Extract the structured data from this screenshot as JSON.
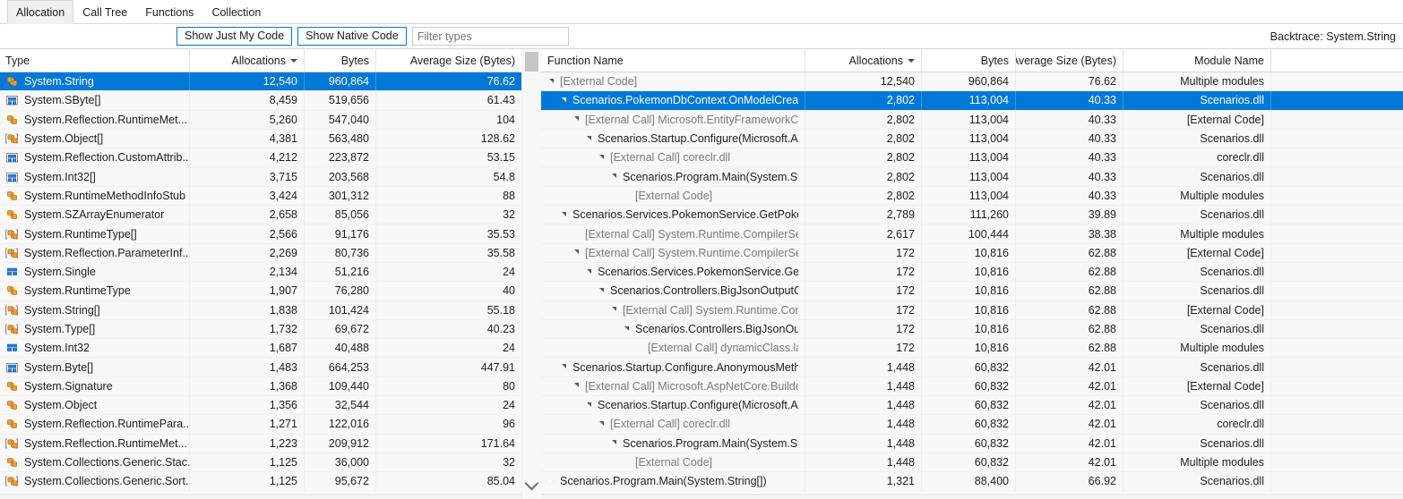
{
  "tabs": [
    {
      "label": "Allocation",
      "active": true
    },
    {
      "label": "Call Tree",
      "active": false
    },
    {
      "label": "Functions",
      "active": false
    },
    {
      "label": "Collection",
      "active": false
    }
  ],
  "toolbar": {
    "just_my_code_label": "Show Just My Code",
    "native_code_label": "Show Native Code",
    "filter_value": "",
    "filter_placeholder": "Filter types",
    "backtrace_label": "Backtrace: System.String"
  },
  "colors": {
    "selection": "#0078d7",
    "accent_border": "#0078d4",
    "row_bg": "#f8f8f8",
    "external_text": "#7a7a7a"
  },
  "types_grid": {
    "columns": [
      {
        "key": "type",
        "label": "Type",
        "align": "left",
        "sorted": false
      },
      {
        "key": "allocations",
        "label": "Allocations",
        "align": "right",
        "sorted": true
      },
      {
        "key": "bytes",
        "label": "Bytes",
        "align": "right",
        "sorted": false
      },
      {
        "key": "average",
        "label": "Average Size (Bytes)",
        "align": "right",
        "sorted": false
      }
    ],
    "rows": [
      {
        "icon": "class-icon",
        "type": "System.String",
        "allocations": "12,540",
        "bytes": "960,864",
        "average": "76.62",
        "selected": true
      },
      {
        "icon": "struct-array-icon",
        "type": "System.SByte[]",
        "allocations": "8,459",
        "bytes": "519,656",
        "average": "61.43",
        "selected": false
      },
      {
        "icon": "class-icon",
        "type": "System.Reflection.RuntimeMet...",
        "allocations": "5,260",
        "bytes": "547,040",
        "average": "104",
        "selected": false
      },
      {
        "icon": "class-array-icon",
        "type": "System.Object[]",
        "allocations": "4,381",
        "bytes": "563,480",
        "average": "128.62",
        "selected": false
      },
      {
        "icon": "struct-array-icon",
        "type": "System.Reflection.CustomAttrib...",
        "allocations": "4,212",
        "bytes": "223,872",
        "average": "53.15",
        "selected": false
      },
      {
        "icon": "struct-array-icon",
        "type": "System.Int32[]",
        "allocations": "3,715",
        "bytes": "203,568",
        "average": "54.8",
        "selected": false
      },
      {
        "icon": "class-icon",
        "type": "System.RuntimeMethodInfoStub",
        "allocations": "3,424",
        "bytes": "301,312",
        "average": "88",
        "selected": false
      },
      {
        "icon": "class-icon",
        "type": "System.SZArrayEnumerator",
        "allocations": "2,658",
        "bytes": "85,056",
        "average": "32",
        "selected": false
      },
      {
        "icon": "class-array-icon",
        "type": "System.RuntimeType[]",
        "allocations": "2,566",
        "bytes": "91,176",
        "average": "35.53",
        "selected": false
      },
      {
        "icon": "class-array-icon",
        "type": "System.Reflection.ParameterInf...",
        "allocations": "2,269",
        "bytes": "80,736",
        "average": "35.58",
        "selected": false
      },
      {
        "icon": "struct-icon",
        "type": "System.Single",
        "allocations": "2,134",
        "bytes": "51,216",
        "average": "24",
        "selected": false
      },
      {
        "icon": "class-icon",
        "type": "System.RuntimeType",
        "allocations": "1,907",
        "bytes": "76,280",
        "average": "40",
        "selected": false
      },
      {
        "icon": "class-array-icon",
        "type": "System.String[]",
        "allocations": "1,838",
        "bytes": "101,424",
        "average": "55.18",
        "selected": false
      },
      {
        "icon": "class-array-icon",
        "type": "System.Type[]",
        "allocations": "1,732",
        "bytes": "69,672",
        "average": "40.23",
        "selected": false
      },
      {
        "icon": "struct-icon",
        "type": "System.Int32",
        "allocations": "1,687",
        "bytes": "40,488",
        "average": "24",
        "selected": false
      },
      {
        "icon": "struct-array-icon",
        "type": "System.Byte[]",
        "allocations": "1,483",
        "bytes": "664,253",
        "average": "447.91",
        "selected": false
      },
      {
        "icon": "class-icon",
        "type": "System.Signature",
        "allocations": "1,368",
        "bytes": "109,440",
        "average": "80",
        "selected": false
      },
      {
        "icon": "class-icon",
        "type": "System.Object",
        "allocations": "1,356",
        "bytes": "32,544",
        "average": "24",
        "selected": false
      },
      {
        "icon": "class-icon",
        "type": "System.Reflection.RuntimePara...",
        "allocations": "1,271",
        "bytes": "122,016",
        "average": "96",
        "selected": false
      },
      {
        "icon": "class-array-icon",
        "type": "System.Reflection.RuntimeMet...",
        "allocations": "1,223",
        "bytes": "209,912",
        "average": "171.64",
        "selected": false
      },
      {
        "icon": "class-icon",
        "type": "System.Collections.Generic.Stac...",
        "allocations": "1,125",
        "bytes": "36,000",
        "average": "32",
        "selected": false
      },
      {
        "icon": "class-array-icon",
        "type": "System.Collections.Generic.Sort...",
        "allocations": "1,125",
        "bytes": "95,672",
        "average": "85.04",
        "selected": false
      }
    ]
  },
  "backtrace_grid": {
    "columns": [
      {
        "key": "function",
        "label": "Function Name",
        "align": "left",
        "sorted": false
      },
      {
        "key": "allocations",
        "label": "Allocations",
        "align": "right",
        "sorted": true
      },
      {
        "key": "bytes",
        "label": "Bytes",
        "align": "right",
        "sorted": false
      },
      {
        "key": "average",
        "label": "Average Size (Bytes)",
        "align": "right",
        "sorted": false
      },
      {
        "key": "module",
        "label": "Module Name",
        "align": "right",
        "sorted": false
      }
    ],
    "rows": [
      {
        "depth": 0,
        "twisty": "expanded",
        "function": "[External Code]",
        "external": true,
        "allocations": "12,540",
        "bytes": "960,864",
        "average": "76.62",
        "module": "Multiple modules",
        "selected": false
      },
      {
        "depth": 1,
        "twisty": "expanded",
        "function": "Scenarios.PokemonDbContext.OnModelCreat...",
        "external": false,
        "allocations": "2,802",
        "bytes": "113,004",
        "average": "40.33",
        "module": "Scenarios.dll",
        "selected": true
      },
      {
        "depth": 2,
        "twisty": "expanded",
        "function": "[External Call] Microsoft.EntityFrameworkC...",
        "external": true,
        "allocations": "2,802",
        "bytes": "113,004",
        "average": "40.33",
        "module": "[External Code]",
        "selected": false
      },
      {
        "depth": 3,
        "twisty": "expanded",
        "function": "Scenarios.Startup.Configure(Microsoft.As...",
        "external": false,
        "allocations": "2,802",
        "bytes": "113,004",
        "average": "40.33",
        "module": "Scenarios.dll",
        "selected": false
      },
      {
        "depth": 4,
        "twisty": "expanded",
        "function": "[External Call] coreclr.dll",
        "external": true,
        "allocations": "2,802",
        "bytes": "113,004",
        "average": "40.33",
        "module": "coreclr.dll",
        "selected": false
      },
      {
        "depth": 5,
        "twisty": "expanded",
        "function": "Scenarios.Program.Main(System.Stri...",
        "external": false,
        "allocations": "2,802",
        "bytes": "113,004",
        "average": "40.33",
        "module": "Scenarios.dll",
        "selected": false
      },
      {
        "depth": 6,
        "twisty": "none",
        "function": "[External Code]",
        "external": true,
        "allocations": "2,802",
        "bytes": "113,004",
        "average": "40.33",
        "module": "Multiple modules",
        "selected": false
      },
      {
        "depth": 1,
        "twisty": "expanded",
        "function": "Scenarios.Services.PokemonService.GetPoke...",
        "external": false,
        "allocations": "2,789",
        "bytes": "111,260",
        "average": "39.89",
        "module": "Scenarios.dll",
        "selected": false
      },
      {
        "depth": 2,
        "twisty": "none",
        "function": "[External Call] System.Runtime.CompilerSer...",
        "external": true,
        "allocations": "2,617",
        "bytes": "100,444",
        "average": "38.38",
        "module": "Multiple modules",
        "selected": false
      },
      {
        "depth": 2,
        "twisty": "expanded",
        "function": "[External Call] System.Runtime.CompilerSer...",
        "external": true,
        "allocations": "172",
        "bytes": "10,816",
        "average": "62.88",
        "module": "[External Code]",
        "selected": false
      },
      {
        "depth": 3,
        "twisty": "expanded",
        "function": "Scenarios.Services.PokemonService.GetP...",
        "external": false,
        "allocations": "172",
        "bytes": "10,816",
        "average": "62.88",
        "module": "Scenarios.dll",
        "selected": false
      },
      {
        "depth": 4,
        "twisty": "expanded",
        "function": "Scenarios.Controllers.BigJsonOutputC...",
        "external": false,
        "allocations": "172",
        "bytes": "10,816",
        "average": "62.88",
        "module": "Scenarios.dll",
        "selected": false
      },
      {
        "depth": 5,
        "twisty": "expanded",
        "function": "[External Call] System.Runtime.Com...",
        "external": true,
        "allocations": "172",
        "bytes": "10,816",
        "average": "62.88",
        "module": "[External Code]",
        "selected": false
      },
      {
        "depth": 6,
        "twisty": "expanded",
        "function": "Scenarios.Controllers.BigJsonOutp...",
        "external": false,
        "allocations": "172",
        "bytes": "10,816",
        "average": "62.88",
        "module": "Scenarios.dll",
        "selected": false
      },
      {
        "depth": 7,
        "twisty": "none",
        "function": "[External Call] dynamicClass.lam...",
        "external": true,
        "allocations": "172",
        "bytes": "10,816",
        "average": "62.88",
        "module": "Multiple modules",
        "selected": false
      },
      {
        "depth": 1,
        "twisty": "expanded",
        "function": "Scenarios.Startup.Configure.AnonymousMeth...",
        "external": false,
        "allocations": "1,448",
        "bytes": "60,832",
        "average": "42.01",
        "module": "Scenarios.dll",
        "selected": false
      },
      {
        "depth": 2,
        "twisty": "expanded",
        "function": "[External Call] Microsoft.AspNetCore.Builde...",
        "external": true,
        "allocations": "1,448",
        "bytes": "60,832",
        "average": "42.01",
        "module": "[External Code]",
        "selected": false
      },
      {
        "depth": 3,
        "twisty": "expanded",
        "function": "Scenarios.Startup.Configure(Microsoft.As...",
        "external": false,
        "allocations": "1,448",
        "bytes": "60,832",
        "average": "42.01",
        "module": "Scenarios.dll",
        "selected": false
      },
      {
        "depth": 4,
        "twisty": "expanded",
        "function": "[External Call] coreclr.dll",
        "external": true,
        "allocations": "1,448",
        "bytes": "60,832",
        "average": "42.01",
        "module": "coreclr.dll",
        "selected": false
      },
      {
        "depth": 5,
        "twisty": "expanded",
        "function": "Scenarios.Program.Main(System.Stri...",
        "external": false,
        "allocations": "1,448",
        "bytes": "60,832",
        "average": "42.01",
        "module": "Scenarios.dll",
        "selected": false
      },
      {
        "depth": 6,
        "twisty": "none",
        "function": "[External Code]",
        "external": true,
        "allocations": "1,448",
        "bytes": "60,832",
        "average": "42.01",
        "module": "Multiple modules",
        "selected": false
      },
      {
        "depth": 0,
        "twisty": "collapsed",
        "function": "Scenarios.Program.Main(System.String[])",
        "external": false,
        "allocations": "1,321",
        "bytes": "88,400",
        "average": "66.92",
        "module": "Scenarios.dll",
        "selected": false
      }
    ]
  },
  "scrollbar": {
    "down_icon": "chevron-down-icon"
  }
}
